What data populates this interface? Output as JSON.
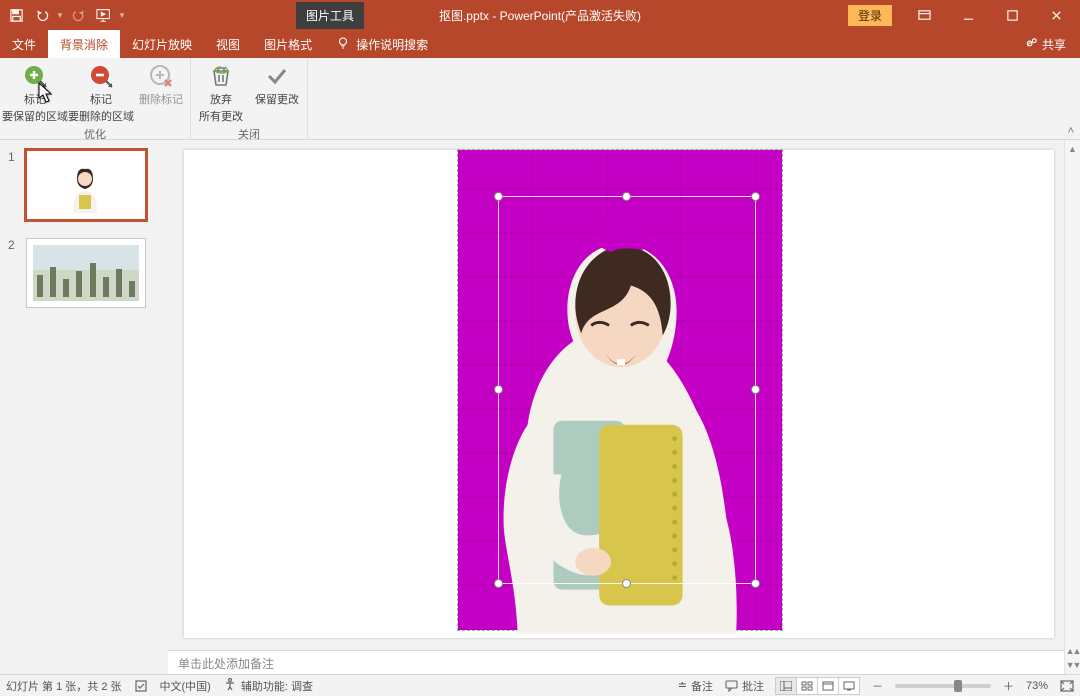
{
  "title_tools_label": "图片工具",
  "title_text": "抠图.pptx - PowerPoint(产品激活失败)",
  "login_badge": "登录",
  "tabs": {
    "file": "文件",
    "bgremove": "背景消除",
    "slideshow": "幻灯片放映",
    "view": "视图",
    "picformat": "图片格式",
    "tellme": "操作说明搜索"
  },
  "share_label": "共享",
  "ribbon": {
    "mark_keep_line1": "标记",
    "mark_keep_line2": "要保留的区域",
    "mark_remove_line1": "标记",
    "mark_remove_line2": "要删除的区域",
    "delete_marks": "删除标记",
    "group_refine": "优化",
    "discard_line1": "放弃",
    "discard_line2": "所有更改",
    "keep_changes": "保留更改",
    "group_close": "关闭"
  },
  "thumbs": {
    "n1": "1",
    "n2": "2"
  },
  "notes_placeholder": "单击此处添加备注",
  "status": {
    "slide_pos": "幻灯片 第 1 张，共 2 张",
    "lang": "中文(中国)",
    "a11y": "辅助功能: 调查",
    "notes": "备注",
    "comments": "批注",
    "zoom_pct": "73%"
  }
}
